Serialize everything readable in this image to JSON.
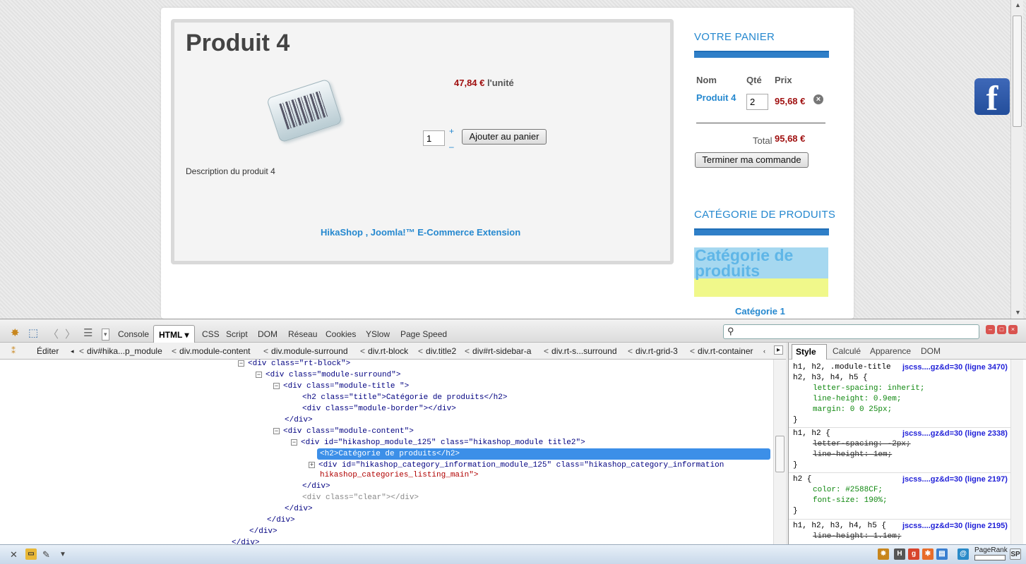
{
  "product": {
    "title": "Produit 4",
    "unit_price_value": "47,84 €",
    "unit_price_label": "l'unité",
    "quantity": "1",
    "stepper_plus": "+",
    "stepper_minus": "–",
    "add_to_cart_label": "Ajouter au panier",
    "description": "Description du produit 4",
    "credit": "HikaShop , Joomla!™ E-Commerce Extension",
    "image_icon": "barcode-icon"
  },
  "cart": {
    "title": "VOTRE PANIER",
    "col_name": "Nom",
    "col_qty": "Qté",
    "col_price": "Prix",
    "item_name": "Produit 4",
    "item_qty": "2",
    "item_price": "95,68 €",
    "total_label": "Total",
    "total_value": "95,68 €",
    "checkout_label": "Terminer ma commande",
    "remove_symbol": "×"
  },
  "categories": {
    "title": "CATÉGORIE DE PRODUITS",
    "header_text": "Catégorie de produits",
    "item_1": "Catégorie 1"
  },
  "social": {
    "facebook_letter": "f"
  },
  "firebug": {
    "tabs": {
      "console": "Console",
      "html": "HTML ▾",
      "css": "CSS",
      "script": "Script",
      "dom": "DOM",
      "net": "Réseau",
      "cookies": "Cookies",
      "yslow": "YSlow",
      "pagespeed": "Page Speed"
    },
    "search_value": "",
    "edit_label": "Éditer",
    "breadcrumb": [
      "div#hika...p_module",
      "div.module-content",
      "div.module-surround",
      "div.rt-block",
      "div.title2",
      "div#rt-sidebar-a",
      "div.rt-s...surround",
      "div.rt-grid-3",
      "div.rt-container"
    ],
    "side_tabs": {
      "style": "Style ▾",
      "computed": "Calculé",
      "layout": "Apparence",
      "dom": "DOM"
    },
    "html_lines": [
      "<div class=\"rt-block\">",
      "<div class=\"module-surround\">",
      "<div class=\"module-title \">",
      "<h2 class=\"title\">Catégorie de produits</h2>",
      "<div class=\"module-border\"></div>",
      "</div>",
      "<div class=\"module-content\">",
      "<div id=\"hikashop_module_125\" class=\"hikashop_module title2\">",
      "<h2>Catégorie de produits</h2>",
      "<div id=\"hikashop_category_information_module_125\" class=\"hikashop_category_information",
      "hikashop_categories_listing_main\">",
      "</div>",
      "<div class=\"clear\"></div>",
      "</div>",
      "</div>",
      "</div>",
      "</div>"
    ],
    "style_rules": [
      {
        "selector": "h1, h2, .module-title",
        "selector2": "h2, h3, h4, h5 {",
        "source": "jscss....gz&d=30 (ligne 3470)",
        "props": [
          "letter-spacing: inherit;",
          "line-height: 0.9em;",
          "margin: 0 0 25px;"
        ]
      },
      {
        "selector": "h1, h2 {",
        "source": "jscss....gz&d=30 (ligne 2338)",
        "props": [
          "letter-spacing: -2px;",
          "line-height: 1em;"
        ]
      },
      {
        "selector": "h2 {",
        "source": "jscss....gz&d=30 (ligne 2197)",
        "props": [
          "color: #2588CF;",
          "font-size: 190%;"
        ]
      },
      {
        "selector": "h1, h2, h3, h4, h5 {",
        "source": "jscss....gz&d=30 (ligne 2195)",
        "props": [
          "line-height: 1.1em;"
        ]
      }
    ],
    "close_brace": "}"
  },
  "status_bar": {
    "pagerank_label": "PageRank",
    "sp_label": "SP"
  },
  "colors": {
    "link_blue": "#2588CF",
    "price_red": "#A01010",
    "selection_blue": "#3C8FE8"
  }
}
